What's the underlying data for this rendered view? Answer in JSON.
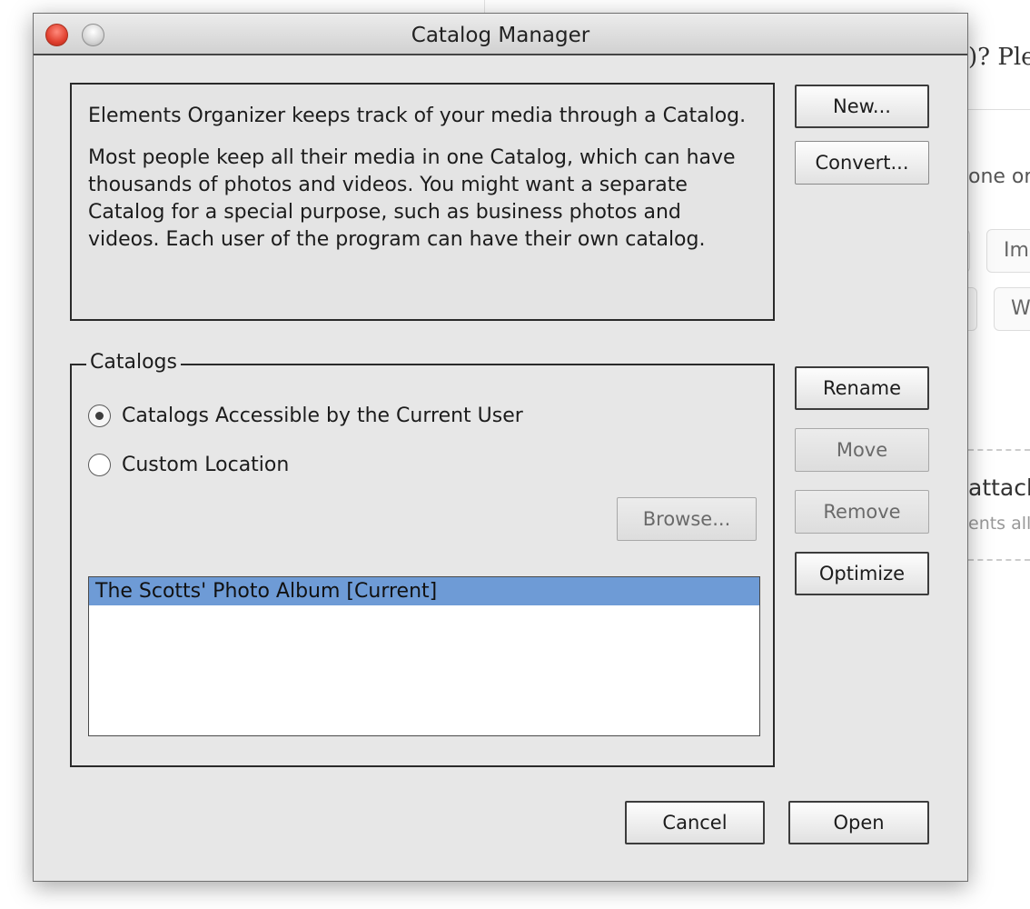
{
  "background": {
    "question_fragment": ")? Ple",
    "text_one": "one or",
    "btn_imp": "Imp",
    "btn_w": "W",
    "attach_fragment": "attach",
    "ents_fragment": "ents all"
  },
  "window": {
    "title": "Catalog Manager"
  },
  "info": {
    "paragraph1": "Elements Organizer keeps track of your media through a Catalog.",
    "paragraph2": "Most people keep all their media in one Catalog, which can have thousands of photos and videos. You might want a separate Catalog for a special purpose, such as business photos and videos. Each user of the program can have their own catalog."
  },
  "buttons": {
    "new": "New...",
    "convert": "Convert...",
    "rename": "Rename",
    "move": "Move",
    "remove": "Remove",
    "optimize": "Optimize",
    "browse": "Browse...",
    "cancel": "Cancel",
    "open": "Open"
  },
  "catalogs": {
    "legend": "Catalogs",
    "radio_current_user": "Catalogs Accessible by the Current User",
    "radio_custom_location": "Custom Location",
    "selected_radio": "current_user",
    "items": [
      {
        "label": "The Scotts' Photo Album [Current]",
        "selected": true
      }
    ]
  },
  "colors": {
    "selection": "#6e9bd6",
    "close_button": "#e0402f",
    "window_bg": "#e7e7e7"
  }
}
